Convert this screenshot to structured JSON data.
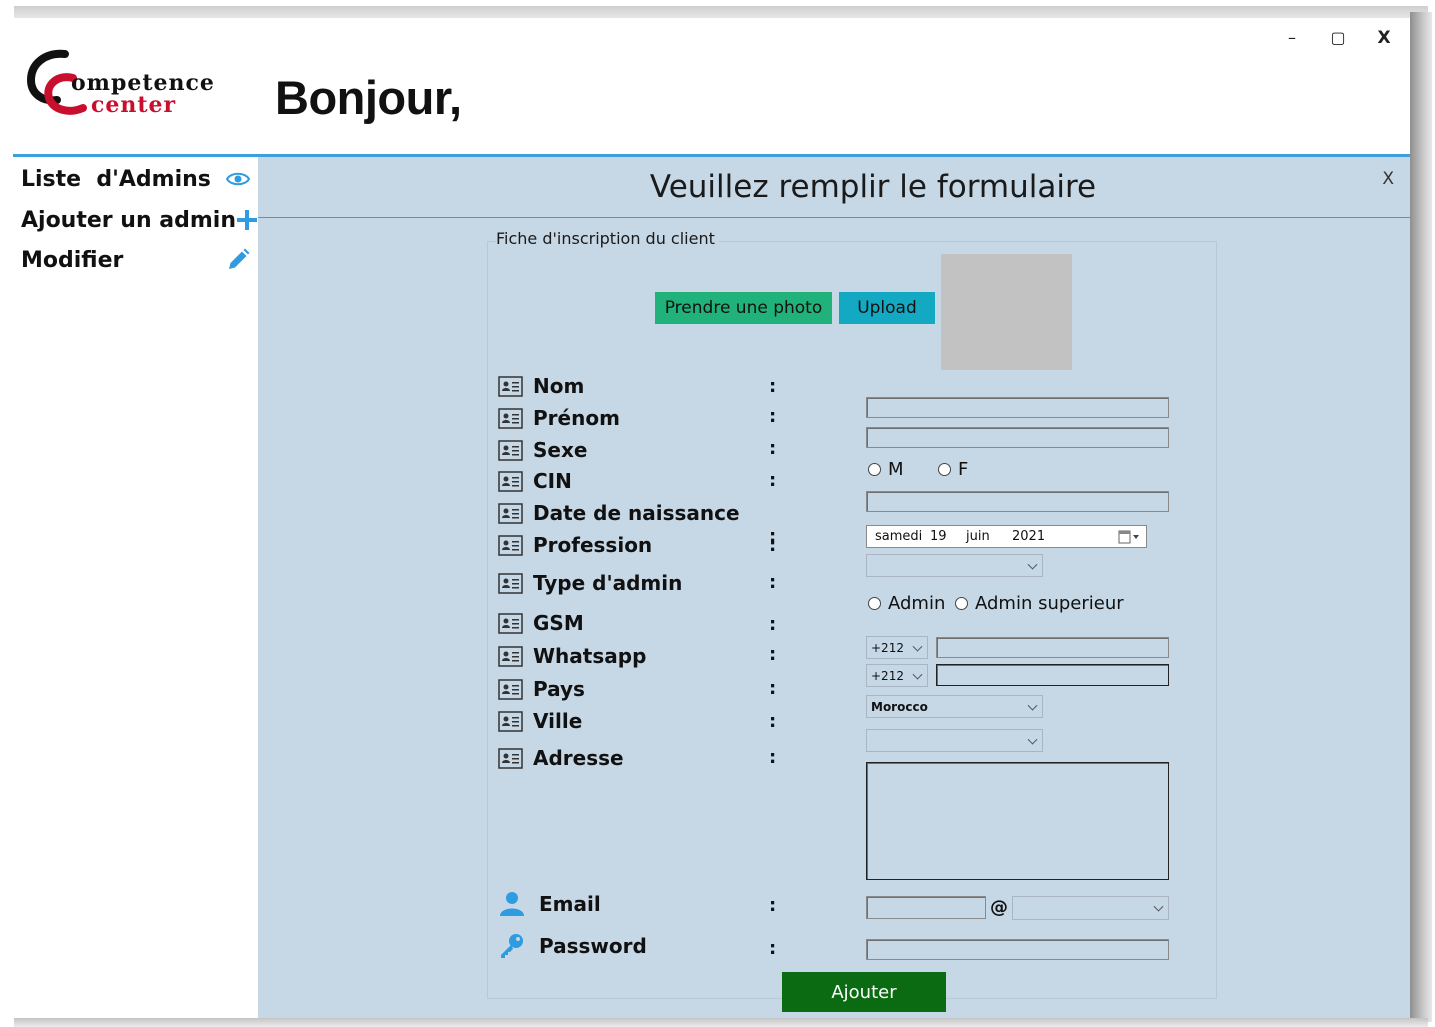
{
  "header": {
    "logo_text_top": "ompetence",
    "logo_text_bottom": "center",
    "greeting": "Bonjour,",
    "minimize_label": "–",
    "maximize_label": "▢",
    "close_label": "X"
  },
  "sidebar": {
    "items": [
      {
        "label": "Liste  d'Admins",
        "icon": "eye-icon"
      },
      {
        "label": "Ajouter un admin",
        "icon": "plus-icon"
      },
      {
        "label": "Modifier",
        "icon": "pencil-icon"
      }
    ]
  },
  "main": {
    "title": "Veuillez remplir le formulaire",
    "close_label": "X",
    "group_title": "Fiche d'inscription du client",
    "photo_button": "Prendre une photo",
    "upload_button": "Upload",
    "colon": ":",
    "fields": {
      "nom": "Nom",
      "prenom": "Prénom",
      "sexe": "Sexe",
      "cin": "CIN",
      "date_naissance": "Date de naissance",
      "profession": "Profession",
      "type_admin": "Type d'admin",
      "gsm": "GSM",
      "whatsapp": "Whatsapp",
      "pays": "Pays",
      "ville": "Ville",
      "adresse": "Adresse",
      "email": "Email",
      "password": "Password"
    },
    "sexe_options": {
      "m": "M",
      "f": "F"
    },
    "type_options": {
      "admin": "Admin",
      "superieur": "Admin superieur"
    },
    "date": {
      "weekday": "samedi",
      "day": "19",
      "month": "juin",
      "year": "2021"
    },
    "gsm_code": "+212",
    "whatsapp_code": "+212",
    "pays_value": "Morocco",
    "at_symbol": "@",
    "submit_button": "Ajouter"
  },
  "colors": {
    "accent_line": "#3aa0e0",
    "panel_bg": "#c6d7e5",
    "photo_button": "#20b27a",
    "upload_button": "#14a9c3",
    "submit_button": "#0b6b12",
    "icon_blue": "#2f9be0"
  }
}
